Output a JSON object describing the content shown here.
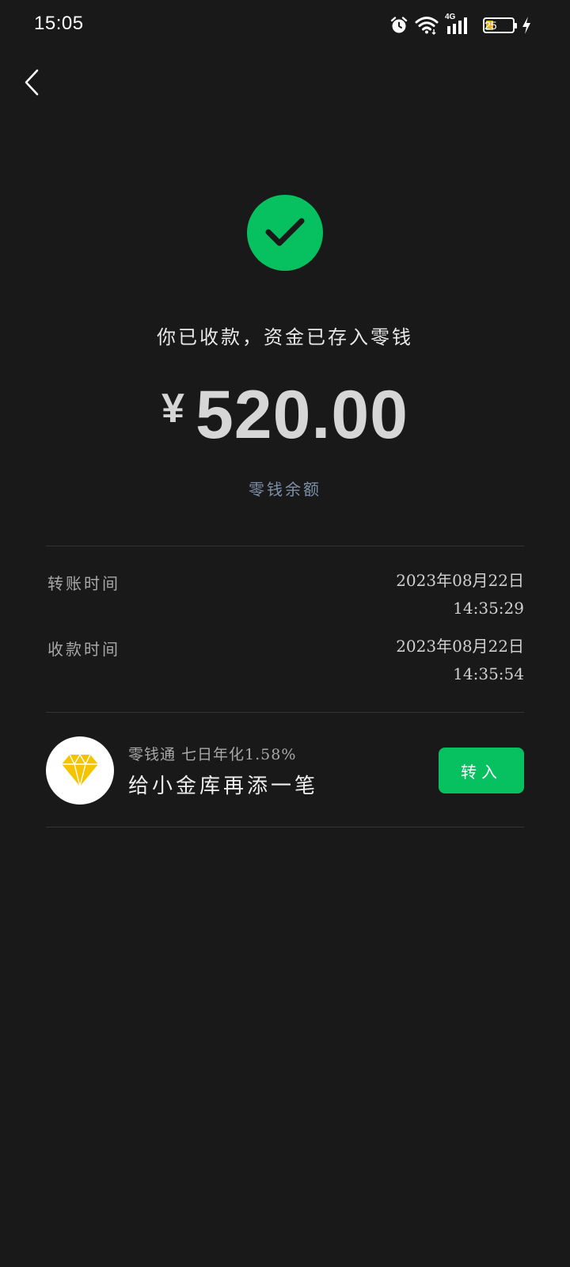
{
  "status_bar": {
    "time": "15:05",
    "battery_level": "25",
    "network": "4G",
    "icons": [
      "alarm-icon",
      "wifi-icon",
      "signal-4g-icon",
      "battery-icon",
      "charging-icon"
    ]
  },
  "nav": {
    "back_icon": "chevron-left-icon"
  },
  "result": {
    "status_icon": "check-circle-icon",
    "message": "你已收款，资金已存入零钱",
    "currency_symbol": "¥",
    "amount": "520.00",
    "balance_link": "零钱余额"
  },
  "details": [
    {
      "label": "转账时间",
      "date": "2023年08月22日",
      "time": "14:35:29"
    },
    {
      "label": "收款时间",
      "date": "2023年08月22日",
      "time": "14:35:54"
    }
  ],
  "promo": {
    "icon": "diamond-icon",
    "subtitle": "零钱通 七日年化1.58%",
    "title": "给小金库再添一笔",
    "button_label": "转入"
  },
  "colors": {
    "background": "#191919",
    "accent_green": "#07c160",
    "link_blue": "#7d90a9",
    "diamond_yellow": "#f5c400"
  }
}
